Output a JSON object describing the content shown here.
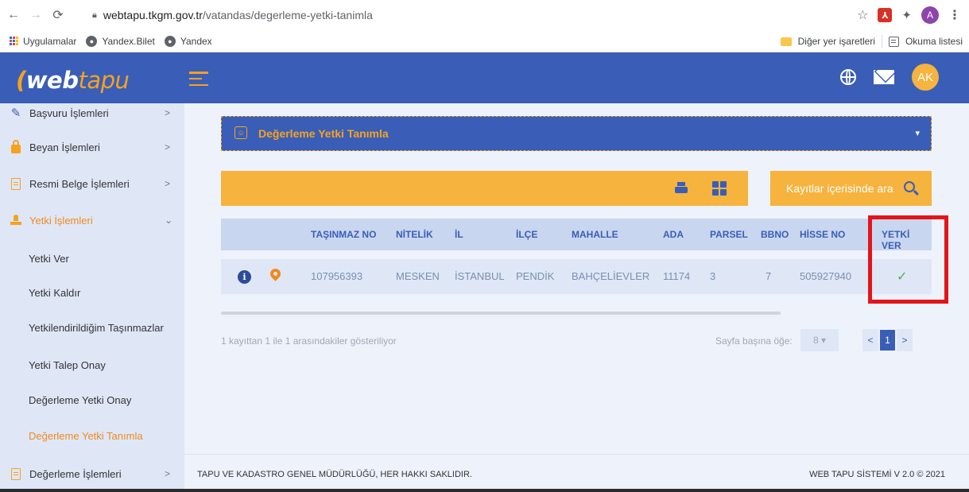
{
  "browser": {
    "url_host": "webtapu.tkgm.gov.tr",
    "url_path": "/vatandas/degerleme-yetki-tanimla",
    "profile_initial": "A",
    "bookmarks": [
      "Uygulamalar",
      "Yandex.Bilet",
      "Yandex"
    ],
    "bookmarks_right": [
      "Diğer yer işaretleri",
      "Okuma listesi"
    ]
  },
  "header": {
    "logo_web": "web",
    "logo_tapu": "tapu",
    "avatar_initials": "AK"
  },
  "sidebar": {
    "items": [
      {
        "label": "Başvuru İşlemleri",
        "arrow": ">"
      },
      {
        "label": "Beyan İşlemleri",
        "arrow": ">"
      },
      {
        "label": "Resmi Belge İşlemleri",
        "arrow": ">"
      },
      {
        "label": "Yetki İşlemleri",
        "arrow": "⌄"
      },
      {
        "label": "Değerleme İşlemleri",
        "arrow": ">"
      }
    ],
    "subitems": [
      "Yetki Ver",
      "Yetki Kaldır",
      "Yetkilendirildiğim Taşınmazlar",
      "Yetki Talep Onay",
      "Değerleme Yetki Onay",
      "Değerleme Yetki Tanımla"
    ]
  },
  "panel": {
    "title": "Değerleme Yetki Tanımla",
    "smiley": "☺"
  },
  "toolbar": {
    "search_label": "Kayıtlar içerisinde ara"
  },
  "table": {
    "columns": [
      "TAŞINMAZ NO",
      "NİTELİK",
      "İL",
      "İLÇE",
      "MAHALLE",
      "ADA",
      "PARSEL",
      "BBNO",
      "HİSSE NO",
      "YETKİ VER"
    ],
    "row": [
      "107956393",
      "MESKEN",
      "İSTANBUL",
      "PENDİK",
      "BAHÇELİEVLER",
      "11174",
      "3",
      "7",
      "505927940"
    ],
    "check": "✓"
  },
  "pagination": {
    "info": "1 kayıttan 1 ile 1 arasındakiler gösteriliyor",
    "per_page_label": "Sayfa başına öğe:",
    "per_page_value": "8 ▾",
    "prev": "<",
    "current": "1",
    "next": ">"
  },
  "footer": {
    "left": "TAPU VE KADASTRO GENEL MÜDÜRLÜĞÜ, HER HAKKI SAKLIDIR.",
    "right": "WEB TAPU SİSTEMİ V 2.0 © 2021"
  },
  "colors": {
    "brand_blue": "#3a5eb7",
    "brand_orange": "#f6b33d",
    "highlight_red": "#e3151a"
  }
}
